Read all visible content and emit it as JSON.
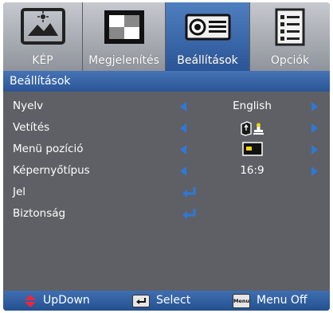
{
  "tabs": [
    {
      "label": "KÉP",
      "icon": "picture-icon",
      "active": false
    },
    {
      "label": "Megjelenítés",
      "icon": "display-icon",
      "active": false
    },
    {
      "label": "Beállítások",
      "icon": "projector-icon",
      "active": true
    },
    {
      "label": "Opciók",
      "icon": "options-icon",
      "active": false
    }
  ],
  "section_title": "Beállítások",
  "rows": [
    {
      "label": "Nyelv",
      "value": "English",
      "has_arrows": true
    },
    {
      "label": "Vetítés",
      "value_icon": "projection-front-desktop-icon",
      "has_arrows": true
    },
    {
      "label": "Menü pozíció",
      "value_icon": "menu-position-icon",
      "has_arrows": true
    },
    {
      "label": "Képernyőtípus",
      "value": "16:9",
      "has_arrows": true
    },
    {
      "label": "Jel",
      "enter_icon": "enter-icon"
    },
    {
      "label": "Biztonság",
      "enter_icon": "enter-icon"
    }
  ],
  "footer": {
    "updown_label": "UpDown",
    "select_label": "Select",
    "menu_key_label": "Menu",
    "menu_off_label": "Menu Off"
  },
  "colors": {
    "accent": "#2c79d9",
    "active_tab": "#2a5597",
    "body_bg": "#5f6065",
    "updown_icon": "#e8283c"
  }
}
